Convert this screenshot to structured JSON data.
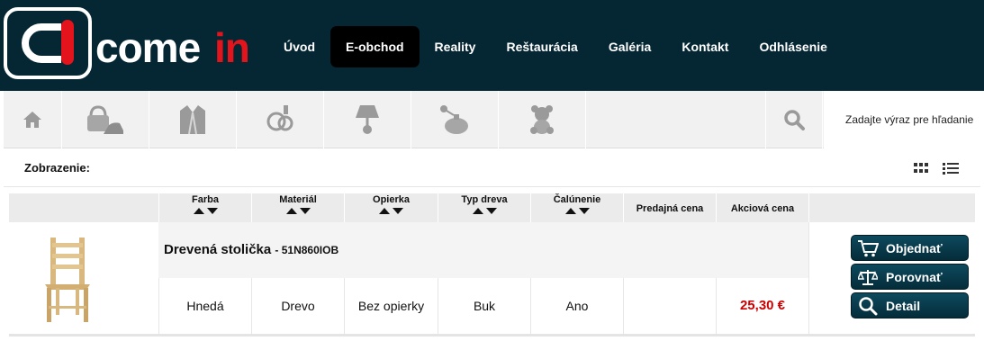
{
  "brand": {
    "logo_text": "COMEIN"
  },
  "nav": {
    "items": [
      {
        "label": "Úvod",
        "active": false
      },
      {
        "label": "E-obchod",
        "active": true
      },
      {
        "label": "Reality",
        "active": false
      },
      {
        "label": "Reštaurácia",
        "active": false
      },
      {
        "label": "Galéria",
        "active": false
      },
      {
        "label": "Kontakt",
        "active": false
      },
      {
        "label": "Odhlásenie",
        "active": false
      }
    ]
  },
  "categories": {
    "icons": [
      "home-icon",
      "shoe-bag-icon",
      "jacket-icon",
      "watch-ring-icon",
      "lamp-icon",
      "perfume-icon",
      "teddy-bear-icon"
    ]
  },
  "search": {
    "placeholder": "Zadajte výraz pre hľadanie",
    "value": ""
  },
  "view": {
    "label": "Zobrazenie:",
    "modes": [
      "grid-view-icon",
      "list-view-icon"
    ]
  },
  "table": {
    "columns": [
      {
        "label": "Farba",
        "sortable": true
      },
      {
        "label": "Materiál",
        "sortable": true
      },
      {
        "label": "Opierka",
        "sortable": true
      },
      {
        "label": "Typ dreva",
        "sortable": true
      },
      {
        "label": "Čalúnenie",
        "sortable": true
      },
      {
        "label": "Predajná cena",
        "sortable": false
      },
      {
        "label": "Akciová cena",
        "sortable": false
      }
    ],
    "rows": [
      {
        "name": "Drevená stolička",
        "code": "- 51N860IOB",
        "cells": [
          "Hnedá",
          "Drevo",
          "Bez opierky",
          "Buk",
          "Ano",
          "",
          "25,30 €"
        ]
      }
    ]
  },
  "actions": {
    "order_label": "Objednať",
    "compare_label": "Porovnať",
    "detail_label": "Detail"
  },
  "colors": {
    "header_bg": "#052633",
    "brand_red": "#e3141b",
    "price_red": "#cc0000",
    "button_bg": "#0d4a5e"
  }
}
